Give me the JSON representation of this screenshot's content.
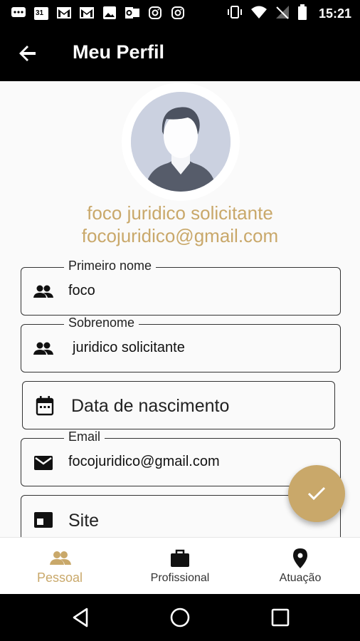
{
  "status_bar": {
    "time": "15:21",
    "left_icons": [
      "chat-icon",
      "calendar-icon",
      "gmail-icon",
      "gmail-icon",
      "image-icon",
      "outlook-icon",
      "instagram-icon",
      "instagram-icon"
    ],
    "calendar_day": "31",
    "right_icons": [
      "vibrate-icon",
      "wifi-icon",
      "no-signal-icon",
      "battery-icon"
    ]
  },
  "app_bar": {
    "title": "Meu Perfil",
    "back_icon": "arrow-back-icon"
  },
  "profile": {
    "name": "foco juridico solicitante",
    "email": "focojuridico@gmail.com"
  },
  "fields": {
    "first_name": {
      "label": "Primeiro nome",
      "value": "foco",
      "icon": "people-icon"
    },
    "last_name": {
      "label": "Sobrenome",
      "value": "juridico solicitante",
      "icon": "people-icon"
    },
    "birth_date": {
      "placeholder": "Data de nascimento",
      "icon": "calendar-icon"
    },
    "email": {
      "label": "Email",
      "value": "focojuridico@gmail.com",
      "icon": "mail-icon"
    },
    "site": {
      "placeholder": "Site",
      "icon": "web-icon"
    }
  },
  "fab": {
    "icon": "check-icon"
  },
  "bottom_nav": {
    "items": [
      {
        "label": "Pessoal",
        "icon": "people-icon",
        "active": true
      },
      {
        "label": "Profissional",
        "icon": "briefcase-icon",
        "active": false
      },
      {
        "label": "Atuação",
        "icon": "location-pin-icon",
        "active": false
      }
    ]
  },
  "colors": {
    "accent": "#c9a86a",
    "bar": "#000000",
    "background": "#fafafa"
  }
}
